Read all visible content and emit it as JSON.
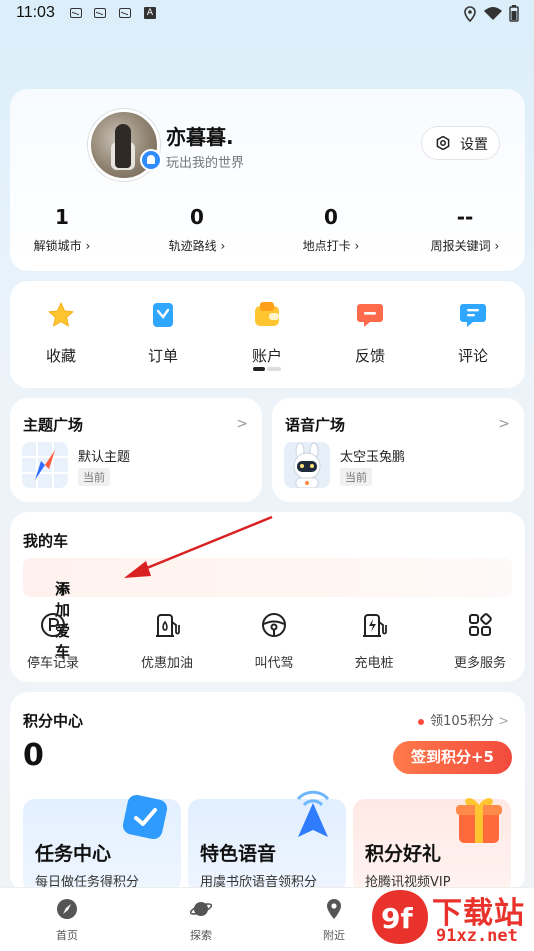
{
  "status_bar": {
    "time": "11:03",
    "icon_letter": "A"
  },
  "profile": {
    "name": "亦暮暮.",
    "signature": "玩出我的世界",
    "settings_label": "设置",
    "stats": [
      {
        "value": "1",
        "label": "解锁城市"
      },
      {
        "value": "0",
        "label": "轨迹路线"
      },
      {
        "value": "0",
        "label": "地点打卡"
      },
      {
        "value": "--",
        "label": "周报关键词"
      }
    ]
  },
  "quick_actions": [
    {
      "label": "收藏",
      "icon": "star-icon"
    },
    {
      "label": "订单",
      "icon": "order-icon"
    },
    {
      "label": "账户",
      "icon": "wallet-icon"
    },
    {
      "label": "反馈",
      "icon": "feedback-icon"
    },
    {
      "label": "评论",
      "icon": "comment-icon"
    }
  ],
  "theme_square": {
    "title": "主题广场",
    "item": "默认主题",
    "tag": "当前"
  },
  "voice_square": {
    "title": "语音广场",
    "item": "太空玉兔鹏",
    "tag": "当前"
  },
  "my_car": {
    "title": "我的车",
    "add_label": "添加爱车",
    "services": [
      {
        "label": "停车记录",
        "icon": "parking-icon"
      },
      {
        "label": "优惠加油",
        "icon": "fuel-icon"
      },
      {
        "label": "叫代驾",
        "icon": "steering-wheel-icon"
      },
      {
        "label": "充电桩",
        "icon": "charging-icon"
      },
      {
        "label": "更多服务",
        "icon": "grid-icon"
      }
    ]
  },
  "points_center": {
    "title": "积分中心",
    "receive_label": "领105积分",
    "points": "0",
    "sign_label": "签到积分+5",
    "cards": [
      {
        "title": "任务中心",
        "subtitle": "每日做任务得积分"
      },
      {
        "title": "特色语音",
        "subtitle": "用虞书欣语音领积分"
      },
      {
        "title": "积分好礼",
        "subtitle": "抢腾讯视频VIP"
      }
    ]
  },
  "tab_bar": [
    {
      "label": "首页",
      "icon": "home-compass-icon"
    },
    {
      "label": "探索",
      "icon": "planet-icon"
    },
    {
      "label": "附近",
      "icon": "location-pin-icon"
    }
  ],
  "watermark": {
    "main": "下载站",
    "sub": "91xz.net",
    "logo": "9f"
  },
  "colors": {
    "accent_orange": "#f24a3d",
    "blue": "#2f8cff",
    "star": "#ffc531"
  }
}
